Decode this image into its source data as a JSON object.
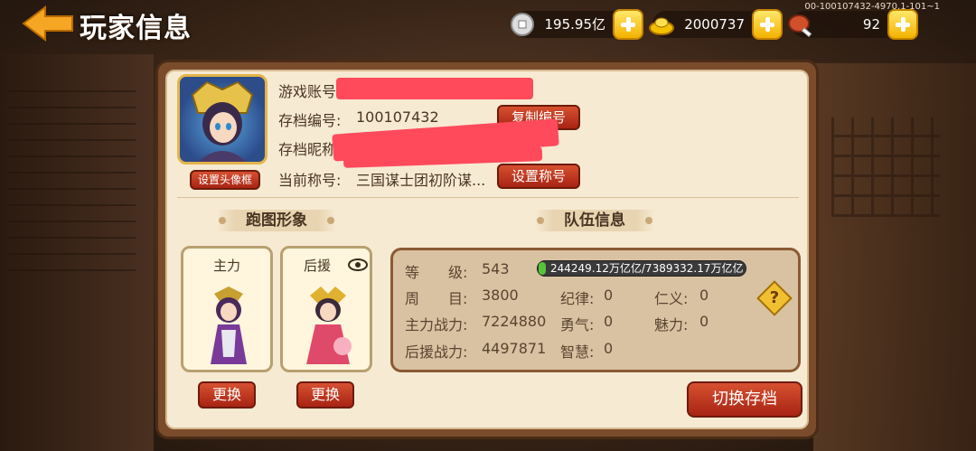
{
  "header": {
    "title": "玩家信息",
    "version": "00-100107432-4970.1-101~1"
  },
  "resources": [
    {
      "icon": "silver-coin-icon",
      "value": "195.95亿"
    },
    {
      "icon": "gold-ingot-icon",
      "value": "2000737"
    },
    {
      "icon": "meat-stamina-icon",
      "value": "92"
    }
  ],
  "profile": {
    "account_label": "游戏账号",
    "save_id_label": "存档编号:",
    "save_id_value": "100107432",
    "nickname_label": "存档昵称",
    "title_label": "当前称号:",
    "title_value": "三国谋士团初阶谋...",
    "copy_btn": "复制编号",
    "set_title_btn": "设置称号",
    "set_frame_btn": "设置头像框"
  },
  "sections": {
    "appearance": "跑图形象",
    "team": "队伍信息"
  },
  "slots": {
    "main": "主力",
    "support": "后援",
    "change_btn": "更换"
  },
  "team": {
    "level_label": "等　　级:",
    "level": "543",
    "exp_text": "244249.12万亿亿/7389332.17万亿亿",
    "exp_progress": 0.033,
    "round_label": "周　　目:",
    "round": "3800",
    "main_power_label": "主力战力:",
    "main_power": "7224880",
    "support_power_label": "后援战力:",
    "support_power": "4497871",
    "discipline_label": "纪律:",
    "discipline": "0",
    "courage_label": "勇气:",
    "courage": "0",
    "wisdom_label": "智慧:",
    "wisdom": "0",
    "benevolence_label": "仁义:",
    "benevolence": "0",
    "charm_label": "魅力:",
    "charm": "0"
  },
  "switch_btn": "切换存档",
  "colors": {
    "accent_gold": "#f3b200",
    "button_red": "#b8321a",
    "panel_bg": "#f6ead3",
    "redaction": "#ff4a5c",
    "exp_green": "#56c43a"
  }
}
